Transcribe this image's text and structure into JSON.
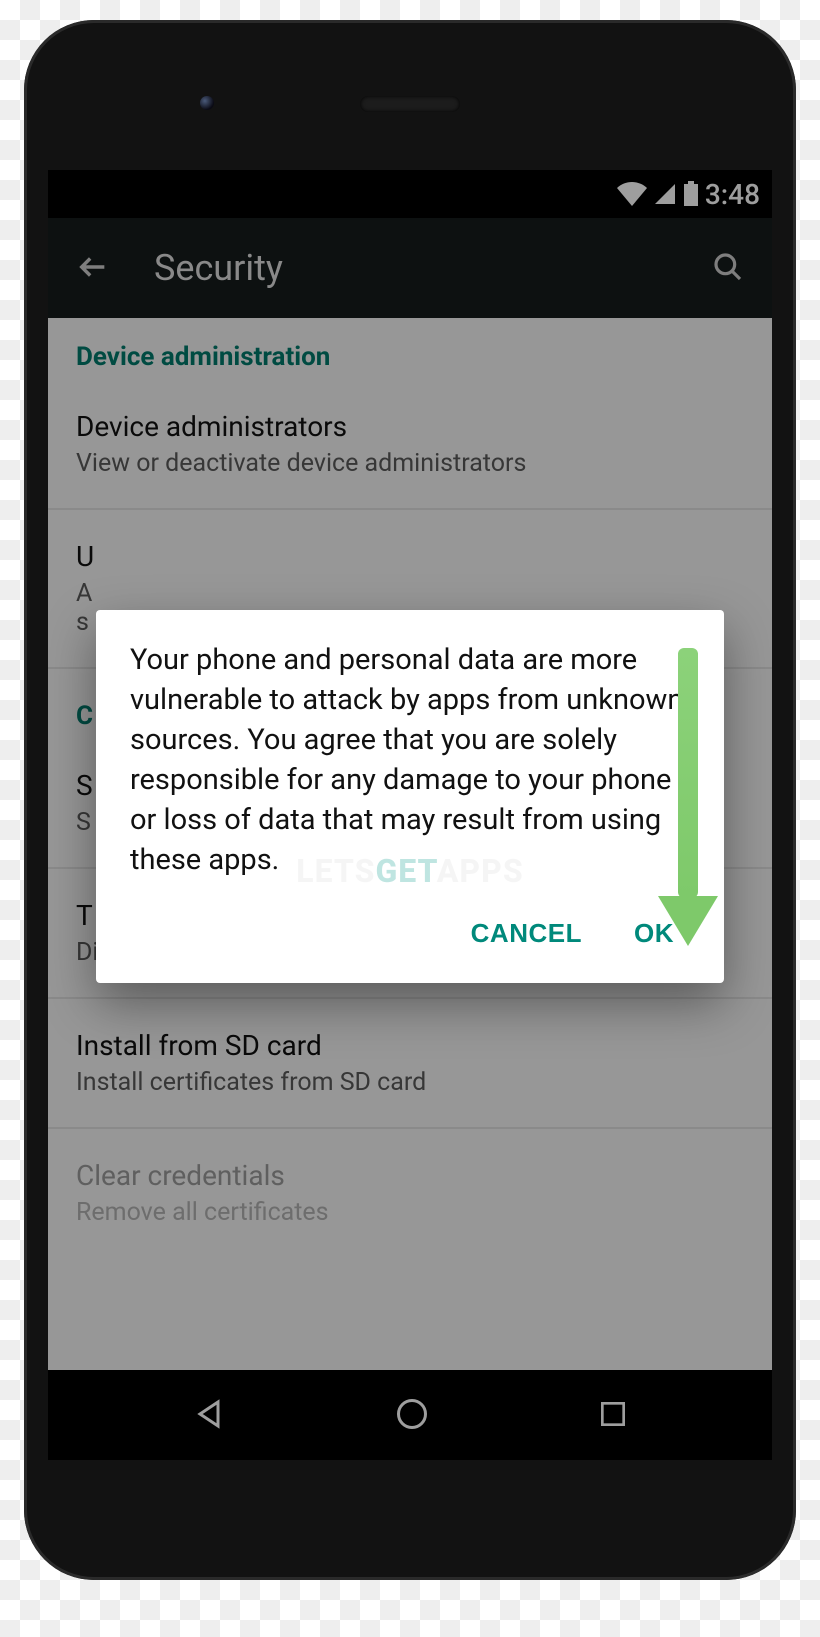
{
  "status": {
    "time": "3:48"
  },
  "appbar": {
    "title": "Security"
  },
  "sections": {
    "device_admin_header": "Device administration",
    "device_admins": {
      "title": "Device administrators",
      "sub": "View or deactivate device administrators"
    },
    "unknown_sources": {
      "title_partial": "U",
      "sub_line1": "A",
      "sub_line2": "s"
    },
    "cred_header": "C",
    "storage_type": {
      "title_partial": "S",
      "sub_partial": "S"
    },
    "trusted": {
      "title_partial": "T",
      "sub": "Display trusted CA certificates"
    },
    "install_sd": {
      "title": "Install from SD card",
      "sub": "Install certificates from SD card"
    },
    "clear_creds": {
      "title": "Clear credentials",
      "sub": "Remove all certificates"
    }
  },
  "dialog": {
    "message": "Your phone and personal data are more vulnerable to attack by apps from unknown sources. You agree that you are solely responsible for any damage to your phone or loss of data that may result from using these apps.",
    "cancel": "CANCEL",
    "ok": "OK"
  },
  "watermark": {
    "part1": "LETS",
    "part2": "GET",
    "part3": "APPS"
  }
}
